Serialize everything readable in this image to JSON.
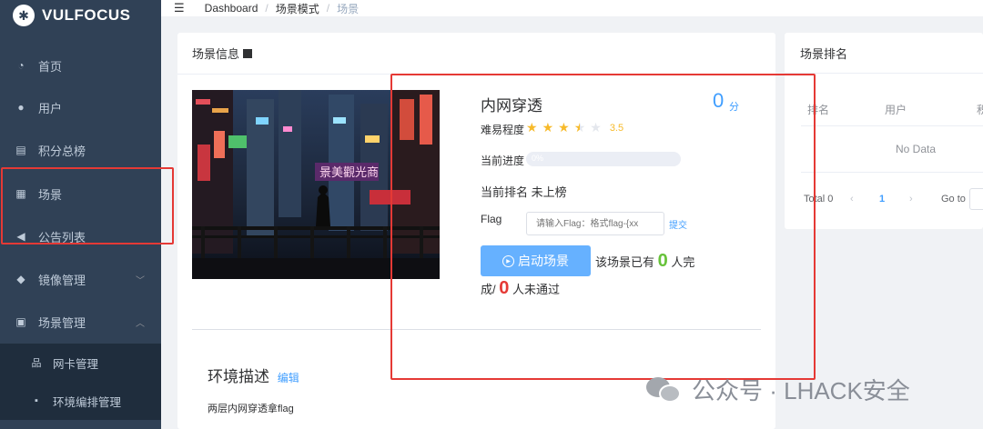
{
  "app": {
    "logo_text": "VULFOCUS"
  },
  "sidebar": {
    "items": [
      {
        "label": "首页",
        "icon": "speedometer-icon"
      },
      {
        "label": "用户",
        "icon": "user-icon"
      },
      {
        "label": "积分总榜",
        "icon": "document-icon"
      },
      {
        "label": "场景",
        "icon": "grid-icon"
      },
      {
        "label": "公告列表",
        "icon": "megaphone-icon"
      },
      {
        "label": "镜像管理",
        "icon": "docker-icon"
      },
      {
        "label": "场景管理",
        "icon": "scene-manage-icon"
      }
    ],
    "sub_items": [
      {
        "label": "网卡管理",
        "icon": "network-icon"
      },
      {
        "label": "环境编排管理",
        "icon": "layout-icon"
      }
    ]
  },
  "breadcrumb": [
    "Dashboard",
    "场景模式",
    "场景"
  ],
  "scene": {
    "header": "场景信息",
    "name": "内网穿透",
    "score": "0",
    "score_unit": "分",
    "difficulty_label": "难易程度",
    "rating": 3.5,
    "rating_text": "3.5",
    "progress_label": "当前进度",
    "progress_percent": 0,
    "progress_text": "0%",
    "rank_label": "当前排名",
    "rank_value": "未上榜",
    "flag_label": "Flag",
    "flag_placeholder": "请输入Flag：格式flag-{xx",
    "submit_label": "提交",
    "start_button": "启动场景",
    "completed_prefix": "该场景已有",
    "completed_count": "0",
    "completed_suffix": "人完",
    "failed_prefix": "成/",
    "failed_count": "0",
    "failed_suffix": "人未通过",
    "env_title": "环境描述",
    "env_edit": "编辑",
    "env_desc": "两层内网穿透拿flag"
  },
  "ranking": {
    "header": "场景排名",
    "columns": [
      "排名",
      "用户",
      "积"
    ],
    "empty_text": "No Data",
    "total_text": "Total 0",
    "current_page": "1",
    "goto_label": "Go to"
  },
  "watermark": "公众号 · LHACK安全",
  "colors": {
    "sidebar": "#304156",
    "primary": "#409eff",
    "star": "#f7ba2a",
    "annotation": "#e53935"
  }
}
